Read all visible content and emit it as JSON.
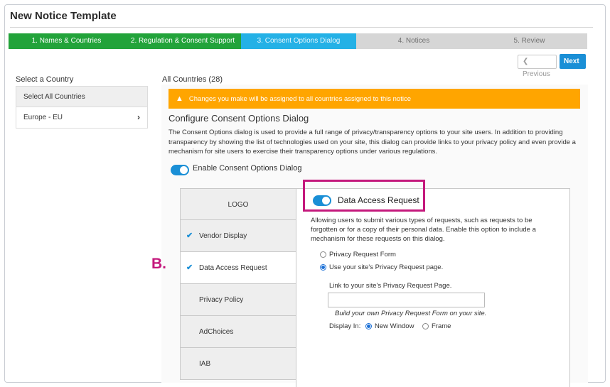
{
  "header": {
    "title": "New Notice Template"
  },
  "wizard": {
    "steps": [
      {
        "label": "1. Names & Countries",
        "state": "done"
      },
      {
        "label": "2. Regulation & Consent Support",
        "state": "done"
      },
      {
        "label": "3. Consent Options Dialog",
        "state": "active"
      },
      {
        "label": "4. Notices",
        "state": "todo"
      },
      {
        "label": "5. Review",
        "state": "todo"
      }
    ]
  },
  "nav": {
    "previous_label": "Previous",
    "next_label": "Next",
    "previous_icon": "chevron-left-icon",
    "next_icon": "chevron-right-icon"
  },
  "left": {
    "heading": "Select a Country",
    "items": [
      {
        "label": "Select All Countries"
      },
      {
        "label": "Europe - EU",
        "icon": "chevron-right-icon"
      }
    ]
  },
  "main": {
    "countries_title": "All Countries (28)",
    "warning": "Changes you make will be assigned to all countries assigned to this notice",
    "warning_icon": "warning-triangle-icon",
    "section_title": "Configure Consent Options Dialog",
    "description": "The Consent Options dialog is used to provide a full range of privacy/transparency options to your site users. In addition to providing transparency by showing the list of technologies used on your site, this dialog can provide links to your privacy policy and even provide a mechanism for site users to exercise their transparency options under various regulations.",
    "enable_label": "Enable Consent Options Dialog"
  },
  "menu": {
    "items": [
      {
        "label": "LOGO",
        "checked": false
      },
      {
        "label": "Vendor Display",
        "checked": true
      },
      {
        "label": "Data Access Request",
        "checked": true
      },
      {
        "label": "Privacy Policy",
        "checked": false
      },
      {
        "label": "AdChoices",
        "checked": false
      },
      {
        "label": "IAB",
        "checked": false
      }
    ]
  },
  "panel": {
    "title": "Data Access Request",
    "description": "Allowing users to submit various types of requests, such as requests to be forgotten or for a copy of their personal data. Enable this option to include a mechanism for these requests on this dialog.",
    "option_form": "Privacy Request Form",
    "option_page": "Use your site's Privacy Request page.",
    "link_label": "Link to your site's Privacy Request Page.",
    "link_value": "",
    "build_note": "Build your own Privacy Request Form on your site.",
    "display_in_label": "Display In:",
    "display_new_window": "New Window",
    "display_frame": "Frame"
  },
  "annotation": {
    "label": "B."
  },
  "colors": {
    "accent": "#1a8fd6",
    "done": "#22a33a",
    "active": "#24b1e6",
    "warning": "#ffa500",
    "highlight": "#c4187c"
  }
}
